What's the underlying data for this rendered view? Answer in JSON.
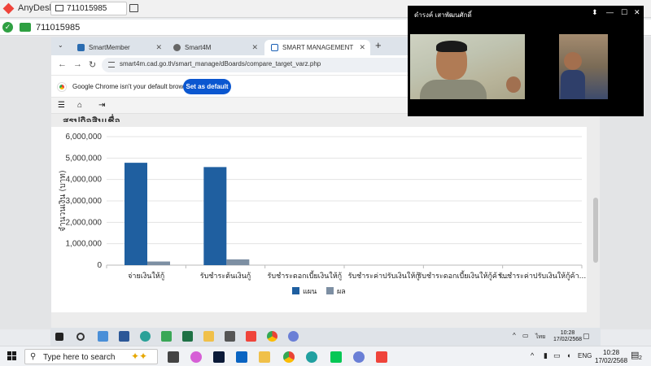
{
  "anydesk": {
    "app_title": "AnyDesk",
    "session_tab": "711015985",
    "address": "711015985"
  },
  "browser": {
    "tabs": [
      {
        "label": "SmartMember",
        "active": false
      },
      {
        "label": "Smart4M",
        "active": false
      },
      {
        "label": "SMART MANAGEMENT",
        "active": true
      }
    ],
    "new_tab": "+",
    "url": "smart4m.cad.go.th/smart_manage/dBoards/compare_target_varz.php",
    "infobar_text": "Google Chrome isn't your default browser",
    "set_default_label": "Set as default"
  },
  "page": {
    "title": "สรุปกิจสินเชื่อ"
  },
  "video": {
    "participant_name": "ดำรงค์ เสาพัฒนศักดิ์"
  },
  "chart_data": {
    "type": "bar",
    "categories": [
      "จ่ายเงินให้กู้",
      "รับชำระต้นเงินกู้",
      "รับชำระดอกเบี้ยเงินให้กู้",
      "รับชำระค่าปรับเงินให้กู้",
      "รับชำระดอกเบี้ยเงินให้กู้ค้า...",
      "รับชำระค่าปรับเงินให้กู้ค้า..."
    ],
    "series": [
      {
        "name": "แผน",
        "color": "#1f5fa0",
        "values": [
          4780000,
          4580000,
          0,
          0,
          0,
          0
        ]
      },
      {
        "name": "ผล",
        "color": "#7d8fa3",
        "values": [
          170000,
          270000,
          0,
          0,
          0,
          0
        ]
      }
    ],
    "ylabel": "จำนวนเงิน (บาท)",
    "ylim": [
      0,
      6000000
    ],
    "yticks": [
      "0",
      "1,000,000",
      "2,000,000",
      "3,000,000",
      "4,000,000",
      "5,000,000",
      "6,000,000"
    ],
    "legend": "bottom",
    "grid": true
  },
  "remote_taskbar": {
    "time": "10:28",
    "date": "17/02/2568",
    "lang": "ไทย"
  },
  "taskbar": {
    "search_placeholder": "Type here to search",
    "lang": "ENG",
    "time": "10:28",
    "date": "17/02/2568",
    "notif_count": "2"
  },
  "colors": {
    "anydesk_red": "#ef443b",
    "chrome_blue": "#0b57d0",
    "bar_plan": "#1f5fa0",
    "bar_actual": "#7d8fa3"
  }
}
